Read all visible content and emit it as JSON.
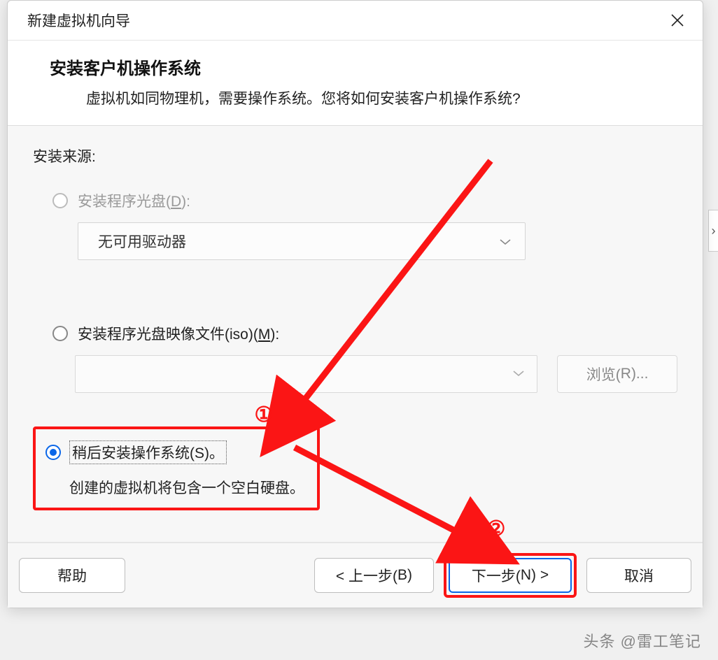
{
  "dialog": {
    "title": "新建虚拟机向导",
    "header_title": "安装客户机操作系统",
    "header_sub": "虚拟机如同物理机，需要操作系统。您将如何安装客户机操作系统?"
  },
  "source": {
    "label": "安装来源:",
    "opt1_prefix": "安装程序光盘(",
    "opt1_key": "D",
    "opt1_suffix": "):",
    "opt1_dropdown": "无可用驱动器",
    "opt2_prefix": "安装程序光盘映像文件(iso)(",
    "opt2_key": "M",
    "opt2_suffix": "):",
    "browse_prefix": "浏览(",
    "browse_key": "R",
    "browse_suffix": ")...",
    "opt3_prefix": "稍后安装操作系统(",
    "opt3_key": "S",
    "opt3_suffix": ")。",
    "opt3_desc": "创建的虚拟机将包含一个空白硬盘。"
  },
  "footer": {
    "help": "帮助",
    "back_prefix": "< 上一步(",
    "back_key": "B",
    "back_suffix": ")",
    "next_prefix": "下一步(",
    "next_key": "N",
    "next_suffix": ") >",
    "cancel": "取消"
  },
  "annotations": {
    "num1": "①",
    "num2": "②"
  },
  "watermark": "头条 @雷工笔记"
}
